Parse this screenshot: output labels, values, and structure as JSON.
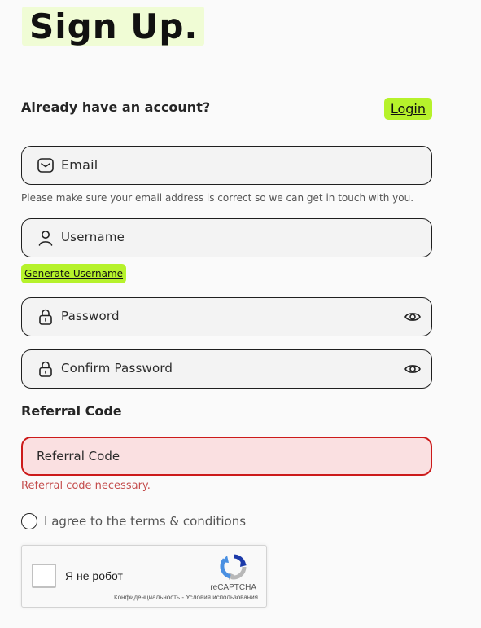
{
  "header": {
    "title": "Sign Up."
  },
  "account": {
    "question": "Already have an account?",
    "login_label": "Login"
  },
  "form": {
    "email_placeholder": "Email",
    "email_hint": "Please make sure your email address is correct so we can get in touch with you.",
    "username_placeholder": "Username",
    "generate_username_label": "Generate Username",
    "password_placeholder": "Password",
    "confirm_password_placeholder": "Confirm Password",
    "referral_heading": "Referral Code",
    "referral_placeholder": "Referral Code",
    "referral_error": "Referral code necessary.",
    "agree_label": "I agree to the terms & conditions"
  },
  "recaptcha": {
    "label": "Я не робот",
    "brand": "reCAPTCHA",
    "privacy_link": "Конфиденциальность",
    "separator": " - ",
    "terms_link": "Условия использования"
  },
  "colors": {
    "accent_green": "#b6f22b",
    "title_highlight": "#f0fcd5",
    "error_red": "#cc1a1a",
    "error_bg": "#fae0e1"
  },
  "icons": {
    "email": "mail-icon",
    "username": "user-icon",
    "password": "lock-icon",
    "confirm_password": "lock-icon",
    "toggle": "eye-icon",
    "captcha": "recaptcha-logo-icon"
  }
}
